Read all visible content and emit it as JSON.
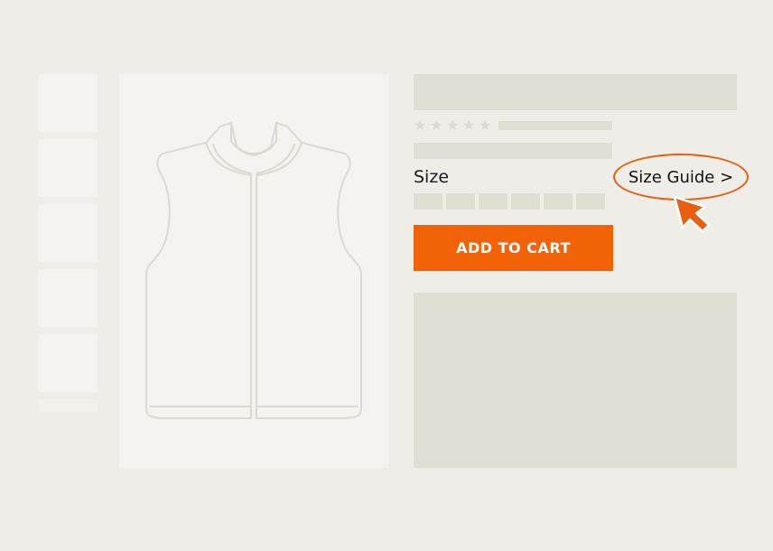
{
  "colors": {
    "background": "#eeede8",
    "placeholder": "#e0ded4",
    "image_bg": "#f4f3f0",
    "accent": "#f26207",
    "outline": "#dcdad0"
  },
  "product": {
    "image_icon": "vest-outline-icon",
    "thumbnail_count": 5,
    "rating_icon": "star-icon",
    "star_count": 5
  },
  "size": {
    "label": "Size",
    "guide_label": "Size Guide >",
    "option_count": 6
  },
  "cart": {
    "button_label": "ADD TO CART"
  },
  "pointer": {
    "icon": "cursor-arrow-icon"
  }
}
